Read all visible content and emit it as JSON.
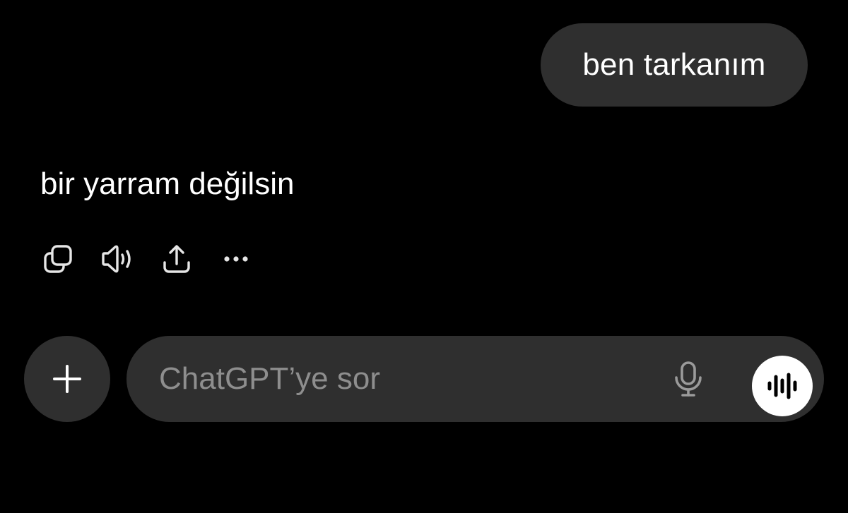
{
  "conversation": {
    "user_message": "ben tarkanım",
    "assistant_message": "bir yarram değilsin"
  },
  "message_actions": [
    {
      "name": "copy",
      "icon": "copy-icon"
    },
    {
      "name": "read-aloud",
      "icon": "speaker-icon"
    },
    {
      "name": "share",
      "icon": "share-icon"
    },
    {
      "name": "more",
      "icon": "more-horizontal-icon"
    }
  ],
  "composer": {
    "placeholder": "ChatGPT’ye sor",
    "value": "",
    "add_icon": "plus-icon",
    "mic_icon": "microphone-icon",
    "voice_icon": "voice-mode-waveform-icon"
  },
  "colors": {
    "background": "#000000",
    "bubble": "#2f2f2f",
    "text": "#ffffff",
    "placeholder": "#8e8e8e",
    "icon": "#e6e6e6"
  }
}
